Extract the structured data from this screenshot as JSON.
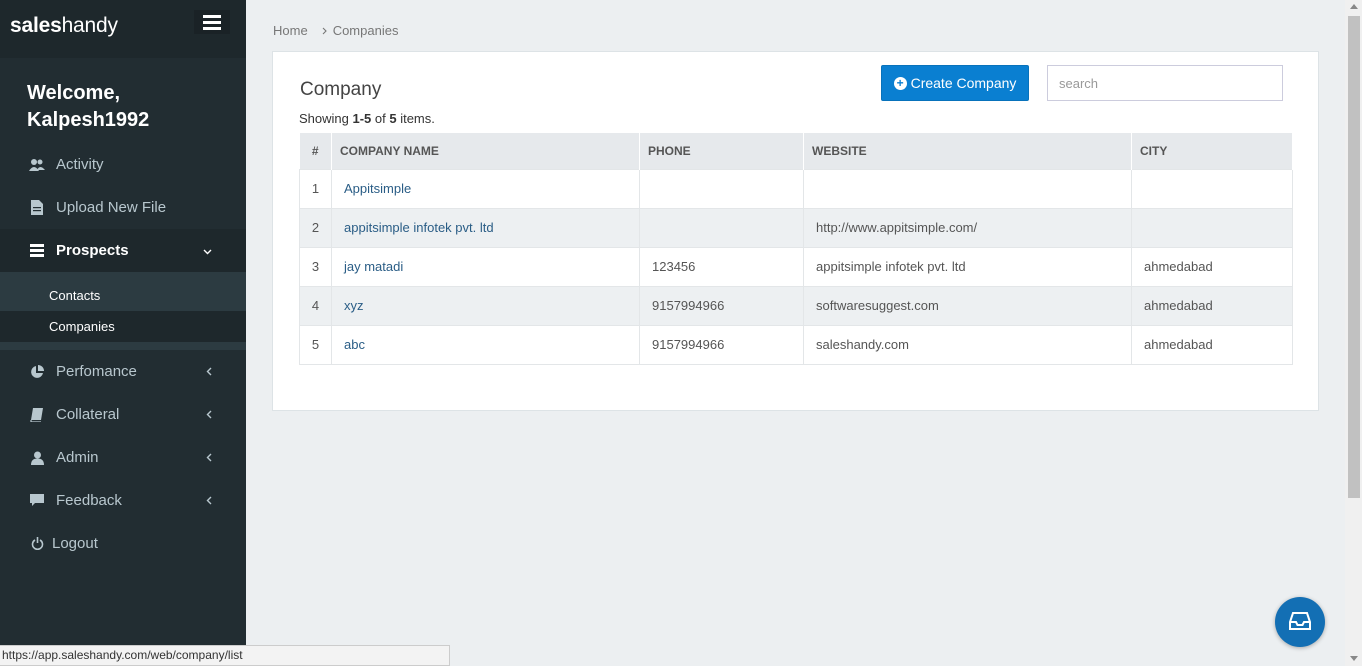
{
  "brand": {
    "bold": "sales",
    "light": "handy"
  },
  "sidebar": {
    "welcome_line1": "Welcome,",
    "welcome_line2": "Kalpesh1992",
    "items": [
      {
        "label": "Activity",
        "icon": "users-icon"
      },
      {
        "label": "Upload New File",
        "icon": "file-icon"
      },
      {
        "label": "Prospects",
        "icon": "list-icon",
        "expanded": true,
        "subitems": [
          {
            "label": "Contacts"
          },
          {
            "label": "Companies",
            "active": true
          }
        ]
      },
      {
        "label": "Perfomance",
        "icon": "pie-chart-icon"
      },
      {
        "label": "Collateral",
        "icon": "book-icon"
      },
      {
        "label": "Admin",
        "icon": "user-icon"
      },
      {
        "label": "Feedback",
        "icon": "comment-icon"
      },
      {
        "label": "Logout",
        "icon": "power-icon"
      }
    ]
  },
  "breadcrumb": {
    "home": "Home",
    "current": "Companies"
  },
  "main": {
    "title": "Company",
    "create_label": "Create Company",
    "search_placeholder": "search",
    "summary": {
      "prefix": "Showing ",
      "range": "1-5",
      "middle": " of ",
      "total": "5",
      "suffix": " items."
    }
  },
  "table": {
    "headers": [
      "#",
      "COMPANY NAME",
      "PHONE",
      "WEBSITE",
      "CITY"
    ],
    "rows": [
      [
        "1",
        "Appitsimple",
        "",
        "",
        ""
      ],
      [
        "2",
        "appitsimple infotek pvt. ltd",
        "",
        "http://www.appitsimple.com/",
        ""
      ],
      [
        "3",
        "jay matadi",
        "123456",
        "appitsimple infotek pvt. ltd",
        "ahmedabad"
      ],
      [
        "4",
        "xyz",
        "9157994966",
        "softwaresuggest.com",
        "ahmedabad"
      ],
      [
        "5",
        "abc",
        "9157994966",
        "saleshandy.com",
        "ahmedabad"
      ]
    ]
  },
  "status_url": "https://app.saleshandy.com/web/company/list",
  "colors": {
    "sidebar": "#222d32",
    "accent": "#0a7fd1",
    "fab": "#136fb4"
  }
}
